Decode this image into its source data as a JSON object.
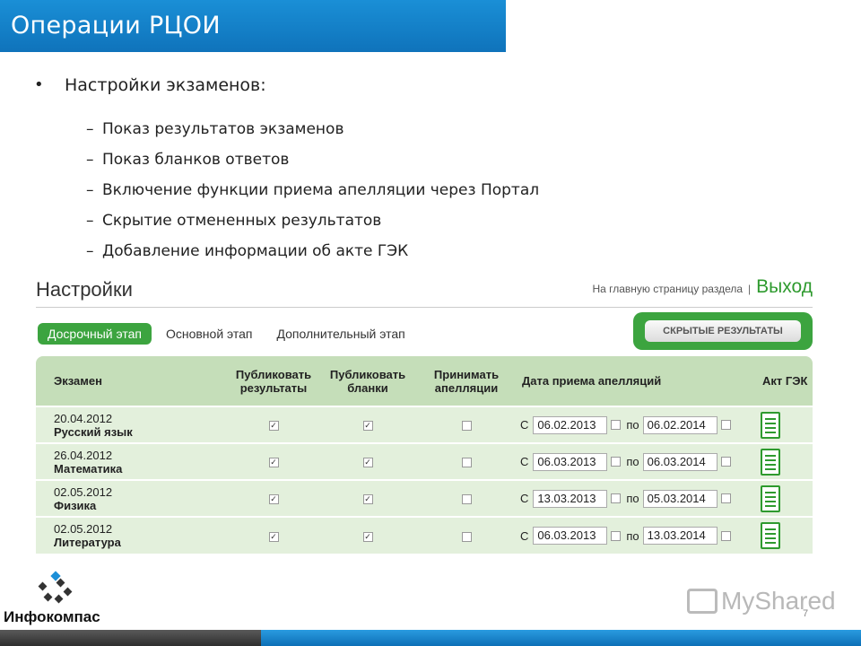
{
  "slide": {
    "title": "Операции РЦОИ",
    "bullet": "Настройки экзаменов:",
    "sub_bullets": [
      "Показ результатов экзаменов",
      "Показ бланков ответов",
      "Включение функции приема апелляции через Портал",
      "Скрытие отмененных результатов",
      "Добавление информации об акте ГЭК"
    ],
    "page_number": "7"
  },
  "panel": {
    "title": "Настройки",
    "home_link": "На главную страницу раздела",
    "separator": "|",
    "logout": "Выход",
    "tabs": [
      "Досрочный этап",
      "Основной этап",
      "Дополнительный этап"
    ],
    "active_tab": "Досрочный этап",
    "hidden_results_button": "СКРЫТЫЕ РЕЗУЛЬТАТЫ",
    "columns": [
      "Экзамен",
      "Публиковать результаты",
      "Публиковать бланки",
      "Принимать апелляции",
      "Дата приема апелляций",
      "Акт ГЭК"
    ],
    "from_label": "С",
    "to_label": "по",
    "rows": [
      {
        "date": "20.04.2012",
        "subject": "Русский язык",
        "publish_results": true,
        "publish_blanks": true,
        "accept_appeals": false,
        "from": "06.02.2013",
        "to": "06.02.2014"
      },
      {
        "date": "26.04.2012",
        "subject": "Математика",
        "publish_results": true,
        "publish_blanks": true,
        "accept_appeals": false,
        "from": "06.03.2013",
        "to": "06.03.2014"
      },
      {
        "date": "02.05.2012",
        "subject": "Физика",
        "publish_results": true,
        "publish_blanks": true,
        "accept_appeals": false,
        "from": "13.03.2013",
        "to": "05.03.2014"
      },
      {
        "date": "02.05.2012",
        "subject": "Литература",
        "publish_results": true,
        "publish_blanks": true,
        "accept_appeals": false,
        "from": "06.03.2013",
        "to": "13.03.2014"
      }
    ]
  },
  "footer": {
    "logo_text": "Инфокомпас",
    "watermark": "MyShared"
  },
  "colors": {
    "title_blue": "#1580c9",
    "accent_green": "#3ca43f",
    "header_green": "#c5deb9",
    "row_green": "#e3f0dc"
  }
}
